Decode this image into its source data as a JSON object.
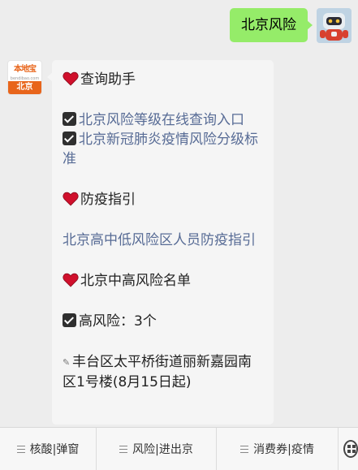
{
  "outgoing": {
    "text": "北京风险"
  },
  "incoming": {
    "avatar": {
      "logo_text": "本地宝",
      "logo_sub": "bendibao.com",
      "city": "北京"
    },
    "section1_title": "查询助手",
    "link1": "北京风险等级在线查询入口",
    "link2": "北京新冠肺炎疫情风险分级标准",
    "section2_title": "防疫指引",
    "link3": "北京高中低风险区人员防疫指引",
    "section3_title": "北京中高风险名单",
    "high_risk_label": "高风险：3个",
    "location1": "丰台区太平桥街道丽新嘉园南区1号楼(8月15日起)"
  },
  "menu": [
    {
      "label": "核酸|弹窗"
    },
    {
      "label": "风险|进出京"
    },
    {
      "label": "消费券|疫情"
    }
  ],
  "colors": {
    "outgoing_bubble": "#95ec69",
    "link": "#576b95",
    "brand": "#e8651b"
  }
}
